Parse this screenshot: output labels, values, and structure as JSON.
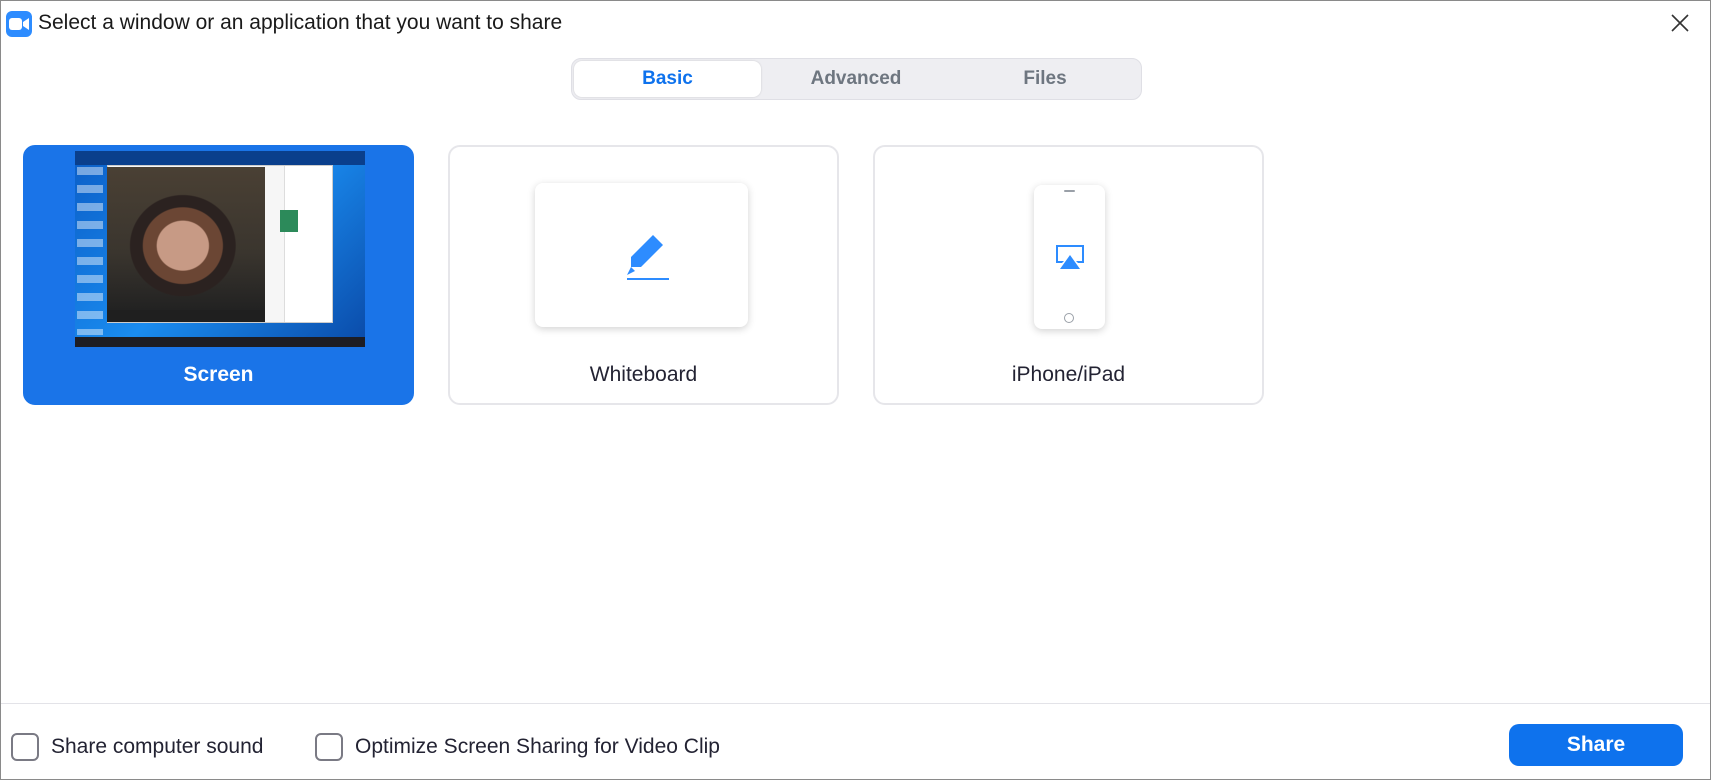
{
  "window": {
    "title": "Select a window or an application that you want to share"
  },
  "icons": {
    "app": "zoom-camera-icon",
    "close": "close-icon",
    "whiteboard": "marker-pen-icon",
    "iphone": "airplay-icon"
  },
  "colors": {
    "accent": "#0e72ed",
    "selected_card": "#1a74e8",
    "icon_blue": "#2D8CFF"
  },
  "tabs": [
    {
      "label": "Basic",
      "active": true
    },
    {
      "label": "Advanced",
      "active": false
    },
    {
      "label": "Files",
      "active": false
    }
  ],
  "cards": [
    {
      "label": "Screen",
      "selected": true
    },
    {
      "label": "Whiteboard",
      "selected": false
    },
    {
      "label": "iPhone/iPad",
      "selected": false
    }
  ],
  "footer": {
    "share_sound_label": "Share computer sound",
    "share_sound_checked": false,
    "optimize_label": "Optimize Screen Sharing for Video Clip",
    "optimize_checked": false,
    "share_button": "Share"
  }
}
